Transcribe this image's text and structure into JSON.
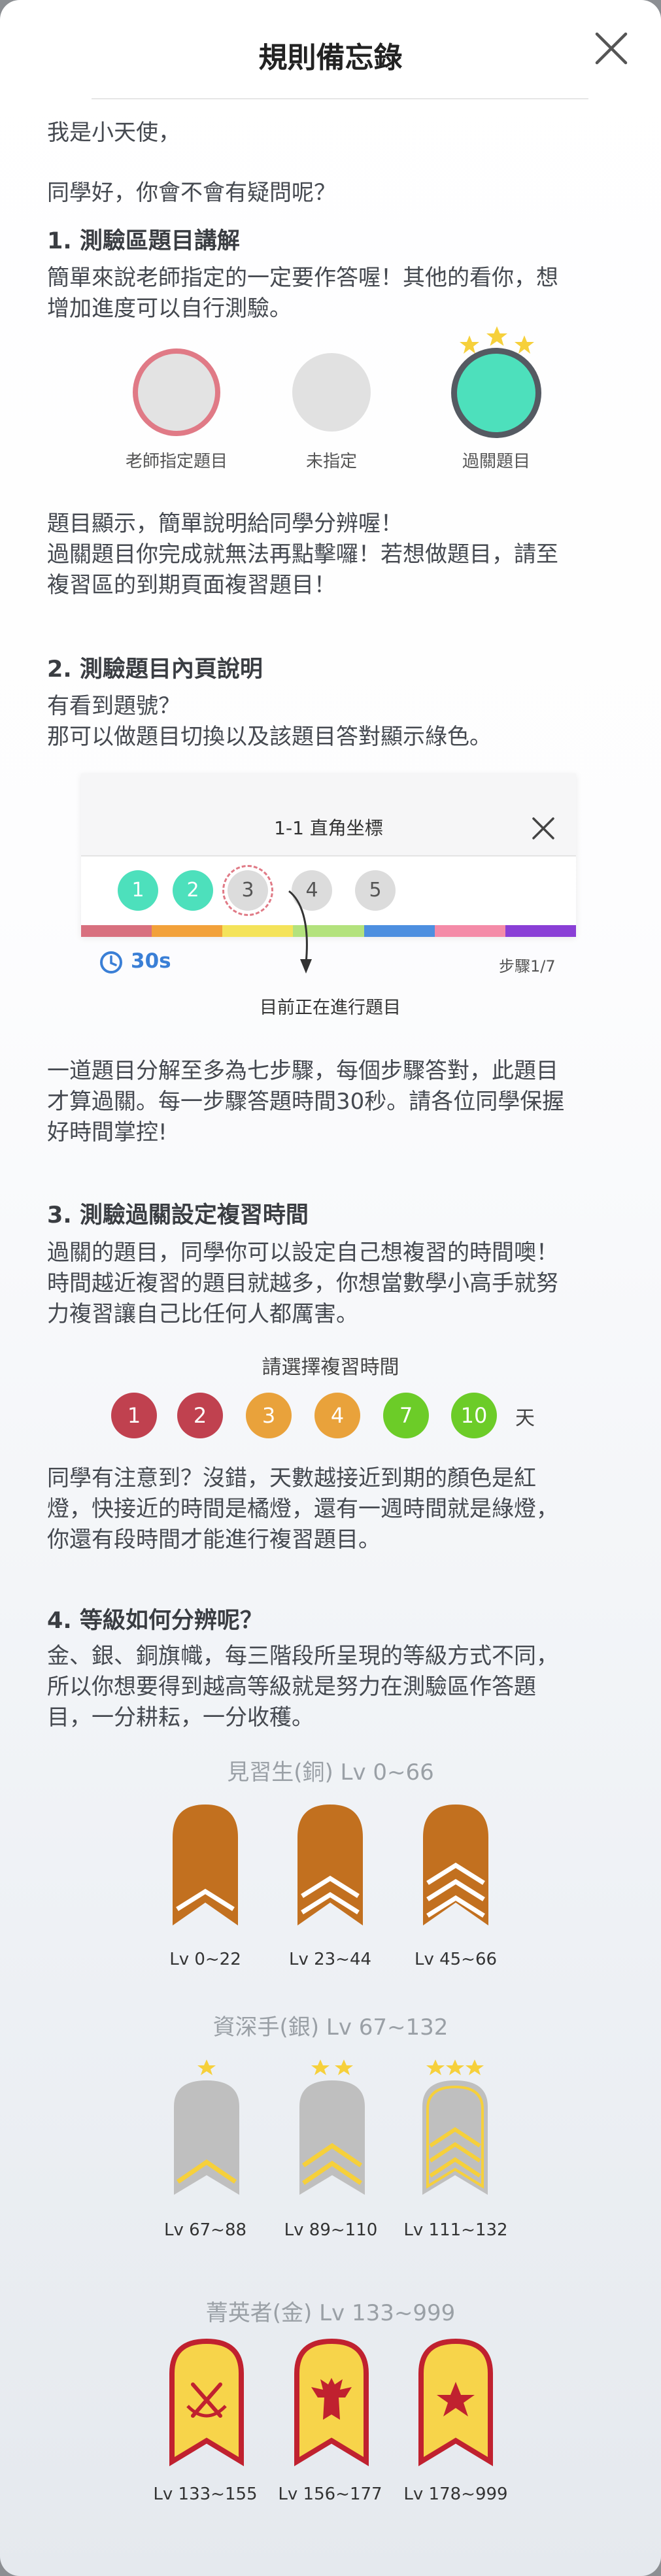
{
  "title": "規則備忘錄",
  "greeting": "我是小天使，",
  "question": "同學好，你會不會有疑問呢？",
  "s1": {
    "heading": "1. 測驗區題目講解",
    "line1": "簡單來說老師指定的一定要作答喔！其他的看你，想",
    "line2": "增加進度可以自行測驗。",
    "legend": [
      "老師指定題目",
      "未指定",
      "過關題目"
    ],
    "p1": "題目顯示，簡單說明給同學分辨喔！",
    "p2": "過關題目你完成就無法再點擊囉！若想做題目，請至",
    "p3": "複習區的到期頁面複習題目！"
  },
  "s2": {
    "heading": "2. 測驗題目內頁說明",
    "line1": "有看到題號？",
    "line2": "那可以做題目切換以及該題目答對顯示綠色。",
    "card_title": "1-1 直角坐標",
    "steps": [
      "1",
      "2",
      "3",
      "4",
      "5"
    ],
    "timer": "30s",
    "step_count": "步驟1/7",
    "pointer_label": "目前正在進行題目",
    "p1": "一道題目分解至多為七步驟，每個步驟答對，此題目",
    "p2": "才算過關。每一步驟答題時間30秒。請各位同學保握",
    "p3": "好時間掌控!"
  },
  "s3": {
    "heading": "3. 測驗過關設定複習時間",
    "line1": "過關的題目，同學你可以設定自己想複習的時間噢！",
    "line2": "時間越近複習的題目就越多，你想當數學小高手就努",
    "line3": "力複習讓自己比任何人都厲害。",
    "prompt": "請選擇複習時間",
    "days": [
      "1",
      "2",
      "3",
      "4",
      "7",
      "10"
    ],
    "day_unit": "天",
    "p1": "同學有注意到？沒錯，天數越接近到期的顏色是紅",
    "p2": "燈，快接近的時間是橘燈，還有一週時間就是綠燈，",
    "p3": "你還有段時間才能進行複習題目。"
  },
  "s4": {
    "heading": "4. 等級如何分辨呢？",
    "line1": "金、銀、銅旗幟，每三階段所呈現的等級方式不同，",
    "line2": "所以你想要得到越高等級就是努力在測驗區作答題",
    "line3": "目，一分耕耘，一分收穫。",
    "bronze_title": "見習生(銅) Lv 0~66",
    "bronze": [
      "Lv 0~22",
      "Lv 23~44",
      "Lv 45~66"
    ],
    "silver_title": "資深手(銀) Lv 67~132",
    "silver": [
      "Lv 67~88",
      "Lv 89~110",
      "Lv 111~132"
    ],
    "gold_title": "菁英者(金) Lv 133~999",
    "gold": [
      "Lv 133~155",
      "Lv 156~177",
      "Lv 178~999"
    ]
  },
  "colors": {
    "teacher_ring": "#e07a86",
    "unassigned": "#dcdcdc",
    "passed": "#4de0bc",
    "red": "#c0414f",
    "orange": "#e9a23b",
    "green": "#6ccc28",
    "bronze": "#c2701f",
    "silver": "#bfbfbf",
    "gold": "#f7d44a"
  }
}
